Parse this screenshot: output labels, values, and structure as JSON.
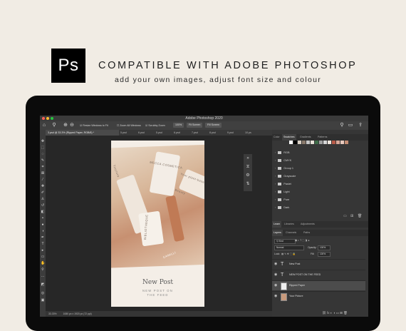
{
  "banner": {
    "logo_text": "Ps",
    "headline": "COMPATIBLE WITH ADOBE PHOTOSHOP",
    "subline": "add your own images, adjust font size and colour"
  },
  "app": {
    "title": "Adobe Photoshop 2020",
    "colors": {
      "close": "#ff5f57",
      "minimize": "#febc2e",
      "maximize": "#28c840"
    }
  },
  "options_bar": {
    "resize_windows": "Resize Windows to Fit",
    "zoom_all_windows": "Zoom All Windows",
    "scrubby_zoom": "Scrubby Zoom",
    "zoom_percent": "100%",
    "fit_screen": "Fit Screen",
    "fill_screen": "Fill Screen"
  },
  "tabs": [
    {
      "label": "3.psd @ 33.3% (Ripped Paper, RGB/8) *",
      "active": true
    },
    {
      "label": "5.psd",
      "active": false
    },
    {
      "label": "6.psd",
      "active": false
    },
    {
      "label": "5.psd",
      "active": false
    },
    {
      "label": "6.psd",
      "active": false
    },
    {
      "label": "7.psd",
      "active": false
    },
    {
      "label": "8.psd",
      "active": false
    },
    {
      "label": "9.psd",
      "active": false
    },
    {
      "label": "10.ps",
      "active": false
    }
  ],
  "document": {
    "title": "New Post",
    "subtitle_line1": "NEW POST ON",
    "subtitle_line2": "THE FEED",
    "product_texts": [
      "Beauty",
      "Your plant-based",
      "BIBLIOTHEQUE",
      "CAMILLI",
      "Tinctura",
      "MECCA COSMETICA"
    ]
  },
  "status_bar": {
    "zoom": "33.33%",
    "doc_size": "1080 px x 1920 px (72 ppi)"
  },
  "swatches_panel": {
    "tabs": [
      "Color",
      "Swatches",
      "Gradients",
      "Patterns"
    ],
    "active_tab": "Swatches",
    "recent_colors": [
      "#ffffff",
      "#000000",
      "#d9d0c5",
      "#8a7a6c",
      "#c8c8c8",
      "#e8e1d8",
      "#3e6b48",
      "#a0a0a0",
      "#d6d6d6",
      "#efe5dc",
      "#b85a48",
      "#d9a899",
      "#e8c9bd",
      "#c48c73"
    ],
    "groups": [
      "RGB",
      "CMYK",
      "Group 1",
      "Grayscale",
      "Pastel",
      "Light",
      "Pure",
      "Dark"
    ]
  },
  "learn_panel": {
    "tabs": [
      "Learn",
      "Libraries",
      "Adjustments"
    ]
  },
  "layers_panel": {
    "tabs": [
      "Layers",
      "Channels",
      "Paths"
    ],
    "filter_kind": "Kind",
    "blend_mode": "Normal",
    "opacity_label": "Opacity:",
    "opacity_value": "100%",
    "lock_label": "Lock:",
    "fill_label": "Fill:",
    "fill_value": "100%",
    "layers": [
      {
        "name": "New Post",
        "type": "text",
        "selected": false
      },
      {
        "name": "NEW POST ON THE FEED",
        "type": "text",
        "selected": false
      },
      {
        "name": "Ripped Paper",
        "type": "image",
        "selected": true
      },
      {
        "name": "Your Picture",
        "type": "image",
        "selected": false
      }
    ]
  }
}
